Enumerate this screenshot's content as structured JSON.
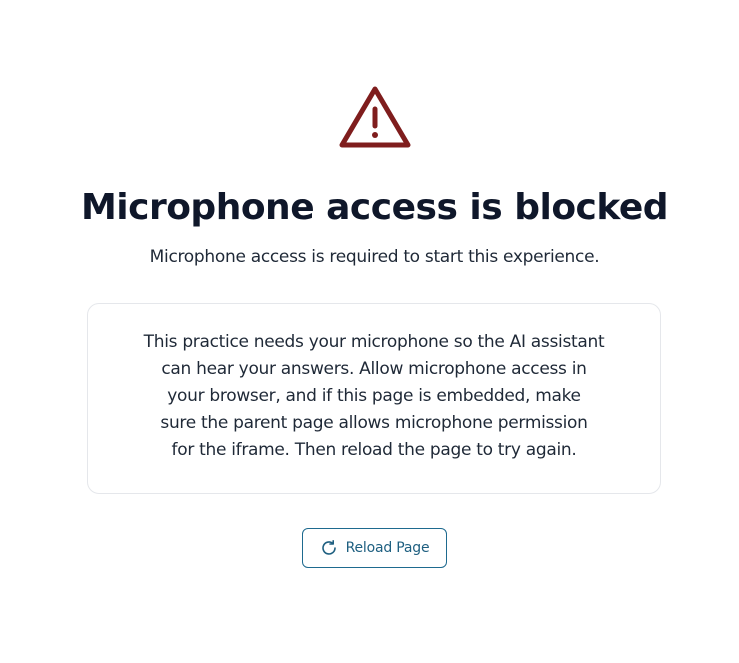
{
  "page": {
    "title": "Microphone access is blocked",
    "subtitle": "Microphone access is required to start this experience.",
    "message_lines": [
      "This practice needs your microphone so the AI assistant",
      "can hear your answers. Allow microphone access in",
      "your browser, and if this page is embedded, make",
      "sure the parent page allows microphone permission",
      "for the iframe. Then reload the page to try again."
    ]
  },
  "reload_button": {
    "label": "Reload Page",
    "icon": "refresh-icon"
  },
  "icons": {
    "warning": "warning-triangle-icon"
  },
  "colors": {
    "warning": "#7f1d1d",
    "accent": "#1e6a8f",
    "title": "#0f172a",
    "card_border": "#e5e7eb"
  }
}
